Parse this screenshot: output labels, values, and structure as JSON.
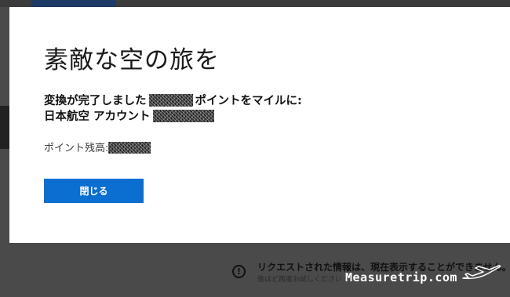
{
  "modal": {
    "title": "素敵な空の旅を",
    "message": {
      "line1_before": "変換が完了しました",
      "line1_after": "ポイントをマイルに:",
      "line2": "日本航空 アカウント"
    },
    "balance_label": "ポイント残高:",
    "close_button": "閉じる"
  },
  "background": {
    "error_title": "リクエストされた情報は、現在表示することができません。",
    "error_subtitle": "後ほど再度お試しください"
  },
  "watermark": "Measuretrip.com",
  "colors": {
    "button": "#0a6fd1",
    "overlay": "#4a4a4a",
    "modal": "#ffffff"
  },
  "icons": {
    "error": "exclamation-circle-icon",
    "watermark": "airplane-icon"
  }
}
